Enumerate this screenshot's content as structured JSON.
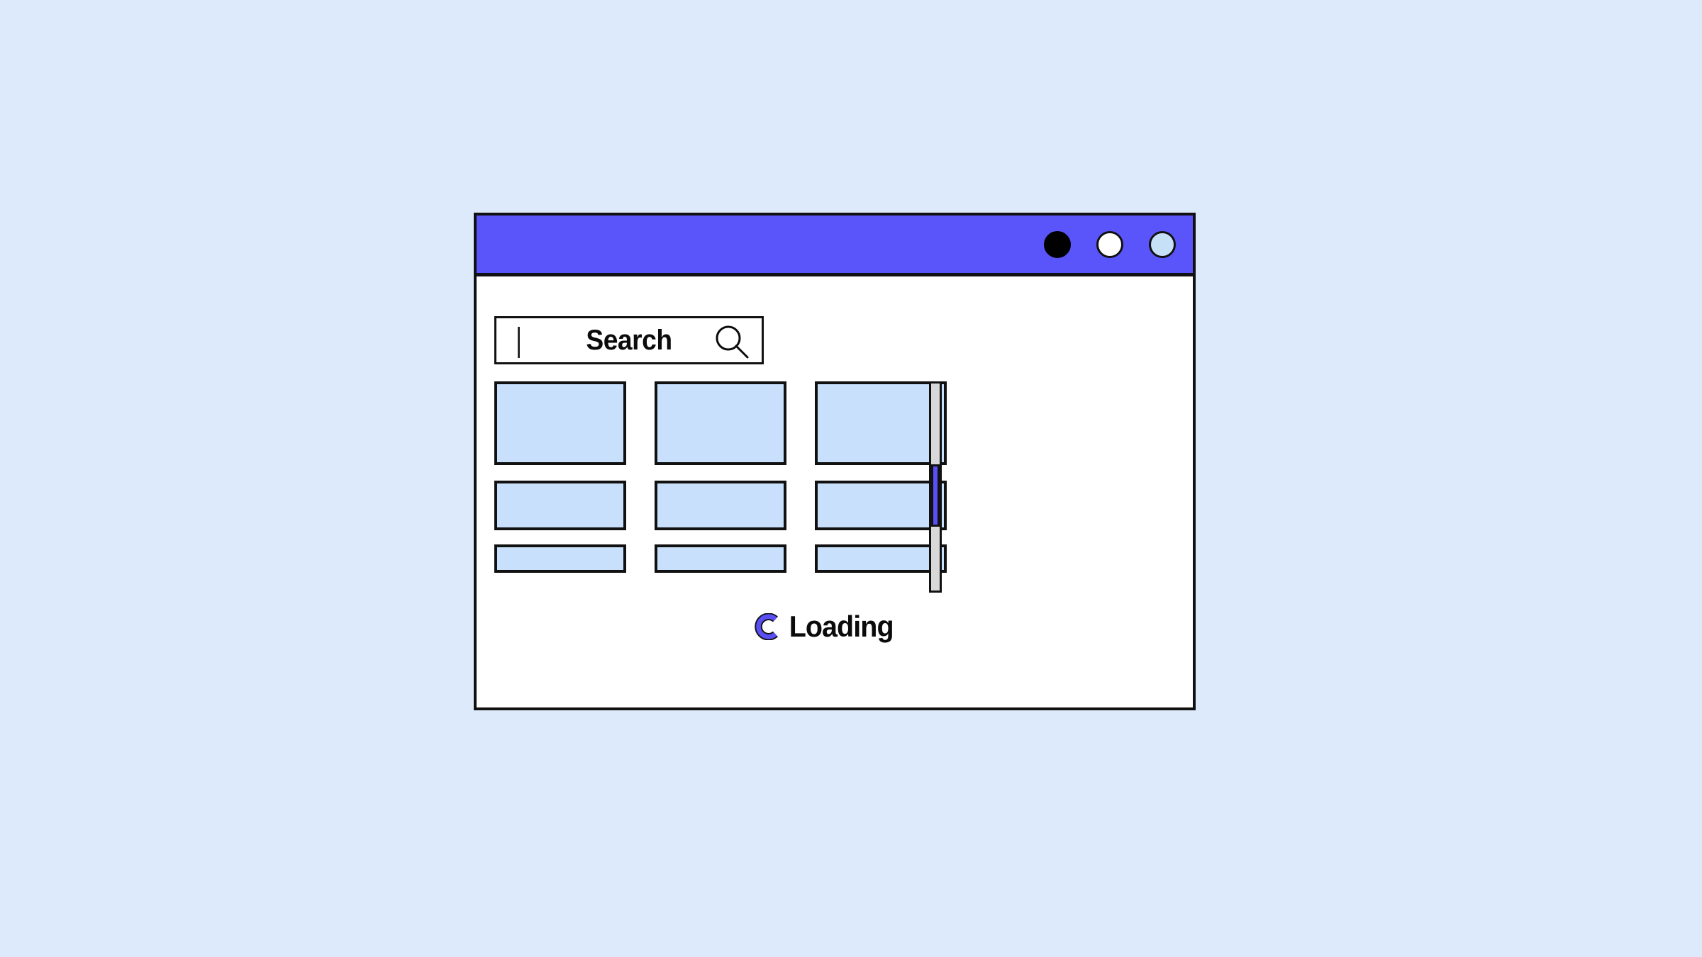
{
  "background_color": "#ddeafc",
  "window": {
    "accent_color": "#5a55fa",
    "border_color": "#111111",
    "body_color": "#ffffff",
    "title_bar": {
      "controls": [
        {
          "name": "close",
          "label": "",
          "fill": "#000000"
        },
        {
          "name": "minimize",
          "label": "",
          "fill": "#ffffff"
        },
        {
          "name": "maximize",
          "label": "",
          "fill": "#c6e0f7"
        }
      ]
    }
  },
  "search": {
    "label": "Search",
    "value": "",
    "placeholder": "Search",
    "icon": "search-icon",
    "caret_visible": true
  },
  "content": {
    "placeholder_color": "#c8e0fb",
    "rows": [
      {
        "height_class": "row-tall",
        "cards": [
          "card-1",
          "card-2",
          "card-3"
        ]
      },
      {
        "height_class": "row-medium",
        "cards": [
          "card-4",
          "card-5",
          "card-6"
        ]
      },
      {
        "height_class": "row-short",
        "cards": [
          "card-7",
          "card-8",
          "card-9"
        ]
      }
    ]
  },
  "scrollbar": {
    "track_color": "#d8d8d8",
    "thumb_color": "#5a4ff5",
    "thumb_position_percent": 38,
    "orientation": "vertical"
  },
  "loading": {
    "label": "Loading",
    "icon": "spinner-icon",
    "spinner_color": "#5a4ff5"
  }
}
